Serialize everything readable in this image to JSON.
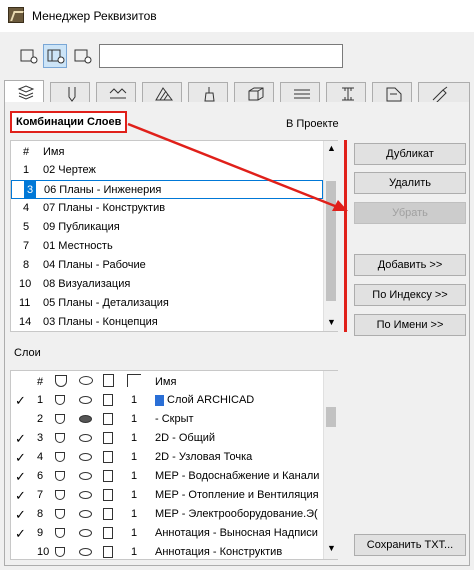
{
  "window": {
    "title": "Менеджер Реквизитов"
  },
  "combo": {
    "label": "Комбинации Слоев",
    "in_project": "В Проекте",
    "col_num": "#",
    "col_name": "Имя",
    "rows": [
      {
        "num": "1",
        "name": "02 Чертеж"
      },
      {
        "num": "3",
        "name": "06 Планы - Инженерия"
      },
      {
        "num": "4",
        "name": "07 Планы - Конструктив"
      },
      {
        "num": "5",
        "name": "09 Публикация"
      },
      {
        "num": "7",
        "name": "01 Местность"
      },
      {
        "num": "8",
        "name": "04 Планы - Рабочие"
      },
      {
        "num": "10",
        "name": "08 Визуализация"
      },
      {
        "num": "11",
        "name": "05 Планы - Детализация"
      },
      {
        "num": "14",
        "name": "03 Планы - Концепция"
      }
    ]
  },
  "buttons": {
    "duplicate": "Дубликат",
    "delete": "Удалить",
    "remove": "Убрать",
    "add": "Добавить >>",
    "by_index": "По Индексу >>",
    "by_name": "По Имени >>",
    "save_txt": "Сохранить TXT..."
  },
  "layers": {
    "label": "Слои",
    "col_num": "#",
    "col_name": "Имя",
    "rows": [
      {
        "check": "✓",
        "num": "1",
        "pen": "1",
        "name": "Слой ARCHICAD"
      },
      {
        "check": "",
        "num": "2",
        "pen": "1",
        "name": "- Скрыт"
      },
      {
        "check": "✓",
        "num": "3",
        "pen": "1",
        "name": "2D - Общий"
      },
      {
        "check": "✓",
        "num": "4",
        "pen": "1",
        "name": "2D - Узловая Точка"
      },
      {
        "check": "✓",
        "num": "6",
        "pen": "1",
        "name": "MEP - Водоснабжение и Канали"
      },
      {
        "check": "✓",
        "num": "7",
        "pen": "1",
        "name": "MEP - Отопление и Вентиляция"
      },
      {
        "check": "✓",
        "num": "8",
        "pen": "1",
        "name": "MEP - Электрооборудование.Э("
      },
      {
        "check": "✓",
        "num": "9",
        "pen": "1",
        "name": "Аннотация - Выносная Надписи"
      },
      {
        "check": "",
        "num": "10",
        "pen": "1",
        "name": "Аннотация - Конструктив"
      }
    ]
  },
  "colors": {
    "accent": "#e0201a",
    "selection": "#0078d7"
  }
}
